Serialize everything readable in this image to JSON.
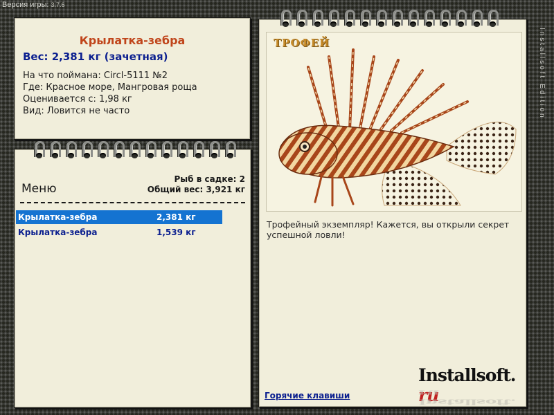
{
  "game_version": {
    "label": "Версия игры:",
    "number": "3.7.6"
  },
  "fish_info": {
    "name": "Крылатка-зебра",
    "weight_line": "Вес: 2,381 кг (зачетная)",
    "caught_on": "На что поймана: Circl-5111 №2",
    "location": "Где: Красное море, Мангровая роща",
    "valued_from": "Оценивается с: 1,98 кг",
    "rarity": "Вид: Ловится не часто"
  },
  "menu": {
    "title": "Меню",
    "fish_count": "Рыб в садке: 2",
    "total_weight": "Общий вес: 3,921 кг",
    "rows": [
      {
        "name": "Крылатка-зебра",
        "weight": "2,381 кг",
        "selected": true
      },
      {
        "name": "Крылатка-зебра",
        "weight": "1,539 кг",
        "selected": false
      }
    ]
  },
  "trophy": {
    "label": "ТРОФЕЙ",
    "description": "Трофейный экземпляр! Кажется, вы открыли секрет успешной ловли!",
    "hotkeys_link": "Горячие клавиши",
    "logo_main": "Installsoft.",
    "logo_ru": "ru"
  },
  "side_text": "Installsoft Edition",
  "colors": {
    "fish_name": "#c0451b",
    "accent_blue": "#0b1f8f",
    "selection": "#1473d1",
    "paper": "#f1eedb"
  }
}
